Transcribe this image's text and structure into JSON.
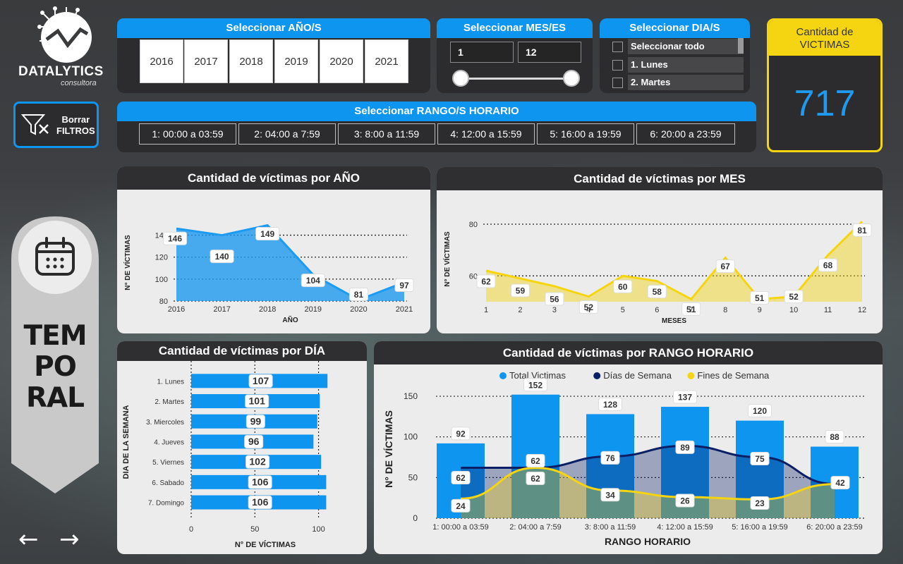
{
  "logo": {
    "name": "DATALYTICS",
    "sub": "consultora"
  },
  "slicers": {
    "anio": {
      "title": "Seleccionar AÑO/S",
      "options": [
        "2016",
        "2017",
        "2018",
        "2019",
        "2020",
        "2021"
      ]
    },
    "mes": {
      "title": "Seleccionar MES/ES",
      "from": "1",
      "to": "12"
    },
    "dia": {
      "title": "Seleccionar DIA/S",
      "options": [
        "Seleccionar todo",
        "1. Lunes",
        "2. Martes"
      ]
    },
    "rango": {
      "title": "Seleccionar RANGO/S HORARIO",
      "options": [
        "1: 00:00 a 03:59",
        "2: 04:00 a 7:59",
        "3: 8:00 a 11:59",
        "4: 12:00 a 15:59",
        "5: 16:00 a 19:59",
        "6: 20:00 a 23:59"
      ]
    }
  },
  "card": {
    "title_line1": "Cantidad de",
    "title_line2": "VICTIMAS",
    "value": "717"
  },
  "clear_filters": {
    "line1": "Borrar",
    "line2": "FILTROS"
  },
  "sidebar": {
    "lines": [
      "TEM",
      "PO",
      "RAL"
    ],
    "prev": "←",
    "next": "→"
  },
  "colors": {
    "accent_blue": "#0e95f0",
    "yellow": "#f5d511",
    "navy": "#0b1f66",
    "dark_panel": "#2c2c2e"
  },
  "chart_data": [
    {
      "id": "por_anio",
      "type": "area",
      "title": "Cantidad de víctimas por AÑO",
      "xlabel": "AÑO",
      "ylabel": "N° DE VÍCTIMAS",
      "categories": [
        "2016",
        "2017",
        "2018",
        "2019",
        "2020",
        "2021"
      ],
      "values": [
        146,
        140,
        149,
        104,
        81,
        97
      ],
      "ylim": [
        80,
        150
      ],
      "yticks": [
        80,
        100,
        120,
        140
      ],
      "color": "#1e9af0"
    },
    {
      "id": "por_mes",
      "type": "area",
      "title": "Cantidad de víctimas por MES",
      "xlabel": "MESES",
      "ylabel": "N° DE VÍCTIMAS",
      "categories": [
        "1",
        "2",
        "3",
        "4",
        "5",
        "6",
        "7",
        "8",
        "9",
        "10",
        "11",
        "12"
      ],
      "values": [
        62,
        59,
        56,
        52,
        60,
        58,
        51,
        67,
        51,
        52,
        68,
        81
      ],
      "ylim": [
        50,
        83
      ],
      "yticks": [
        60,
        80
      ],
      "color": "#f5d511"
    },
    {
      "id": "por_dia",
      "type": "bar",
      "orientation": "horizontal",
      "title": "Cantidad de víctimas por DÍA",
      "xlabel": "N° DE VÍCTIMAS",
      "ylabel": "DIA DE LA SEMANA",
      "categories": [
        "1. Lunes",
        "2. Martes",
        "3. Miercoles",
        "4. Jueves",
        "5. Viernes",
        "6. Sabado",
        "7. Domingo"
      ],
      "values": [
        107,
        101,
        99,
        96,
        102,
        106,
        106
      ],
      "xlim": [
        0,
        108
      ],
      "xticks": [
        0,
        50,
        100
      ],
      "color": "#0e95f0"
    },
    {
      "id": "por_rango",
      "type": "bar",
      "title": "Cantidad de víctimas por RANGO HORARIO",
      "xlabel": "RANGO HORARIO",
      "ylabel": "N° DE VÍCTIMAS",
      "categories": [
        "1: 00:00 a 03:59",
        "2: 04:00 a 7:59",
        "3: 8:00 a 11:59",
        "4: 12:00 a 15:59",
        "5: 16:00 a 19:59",
        "6: 20:00 a 23:59"
      ],
      "ylim": [
        0,
        170
      ],
      "yticks": [
        0,
        50,
        100,
        150
      ],
      "legend_position": "top",
      "series": [
        {
          "name": "Total Victimas",
          "kind": "bar",
          "color": "#0e95f0",
          "values": [
            92,
            152,
            128,
            137,
            120,
            88
          ]
        },
        {
          "name": "Días de Semana",
          "kind": "area",
          "color": "#0b1f66",
          "values": [
            62,
            62,
            76,
            89,
            75,
            42
          ]
        },
        {
          "name": "Fines de Semana",
          "kind": "area",
          "color": "#f5d511",
          "values": [
            24,
            62,
            34,
            26,
            23,
            42
          ]
        }
      ]
    }
  ]
}
